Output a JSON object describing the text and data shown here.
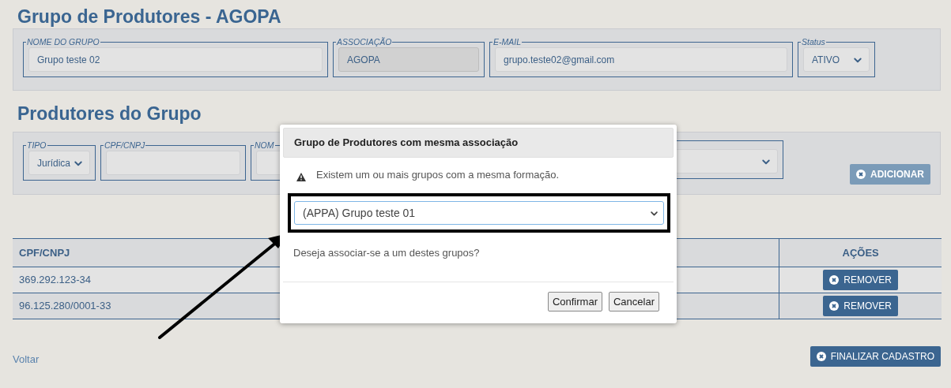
{
  "page_title": "Grupo de Produtores - AGOPA",
  "group_fields": [
    {
      "label": "NOME DO GRUPO",
      "kind": "input",
      "value": "Grupo teste 02",
      "readonly": false
    },
    {
      "label": "ASSOCIAÇÃO",
      "kind": "input",
      "value": "AGOPA",
      "readonly": true
    },
    {
      "label": "E-MAIL",
      "kind": "input",
      "value": "grupo.teste02@gmail.com",
      "readonly": false
    },
    {
      "label": "Status",
      "kind": "select",
      "value": "ATIVO"
    }
  ],
  "producers_title": "Produtores do Grupo",
  "producer_fields": [
    {
      "label": "TIPO",
      "kind": "select",
      "value": "Jurídica"
    },
    {
      "label": "CPF/CNPJ",
      "kind": "input",
      "readonly": false
    },
    {
      "label": "NOM",
      "kind": "input",
      "readonly": false
    },
    {
      "kind": "select"
    }
  ],
  "add_button": {
    "label": "ADICIONAR",
    "disabled": true
  },
  "table": {
    "columns": [
      {
        "label": "CPF/CNPJ"
      },
      {},
      {},
      {
        "label": "AÇÕES"
      }
    ],
    "rows": [
      {
        "cpf_cnpj": "369.292.123-34",
        "action": "REMOVER"
      },
      {
        "cpf_cnpj": "96.125.280/0001-33",
        "action": "REMOVER"
      }
    ]
  },
  "back_link": "Voltar",
  "finish_button": "FINALIZAR CADASTRO",
  "modal": {
    "title": "Grupo de Produtores com mesma associação",
    "warning": "Existem um ou mais grupos com a mesma formação.",
    "select_value": "(APPA) Grupo teste 01",
    "question": "Deseja associar-se a um destes grupos?",
    "buttons": [
      "Confirmar",
      "Cancelar"
    ]
  }
}
